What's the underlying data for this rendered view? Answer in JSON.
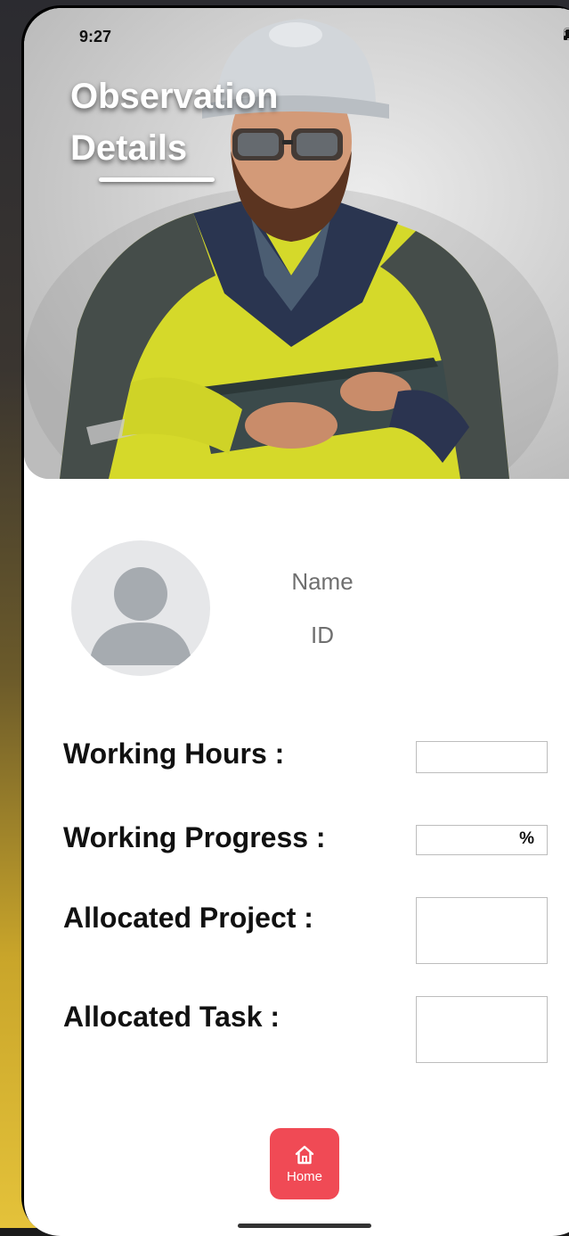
{
  "status_bar": {
    "time": "9:27"
  },
  "header": {
    "title": "Observation Details"
  },
  "profile": {
    "name_label": "Name",
    "id_label": "ID"
  },
  "form": {
    "working_hours": {
      "label": "Working Hours :",
      "value": ""
    },
    "working_progress": {
      "label": "Working Progress :",
      "value": "",
      "unit": "%"
    },
    "allocated_project": {
      "label": "Allocated Project :",
      "value": ""
    },
    "allocated_task": {
      "label": "Allocated Task :",
      "value": ""
    }
  },
  "nav": {
    "home_label": "Home",
    "home_icon": "home-icon"
  },
  "colors": {
    "accent": "#f04a55",
    "label_text": "#111111",
    "muted_text": "#6f6f6f",
    "jacket_yellow": "#d8dc2a",
    "jacket_navy": "#2a3550"
  }
}
